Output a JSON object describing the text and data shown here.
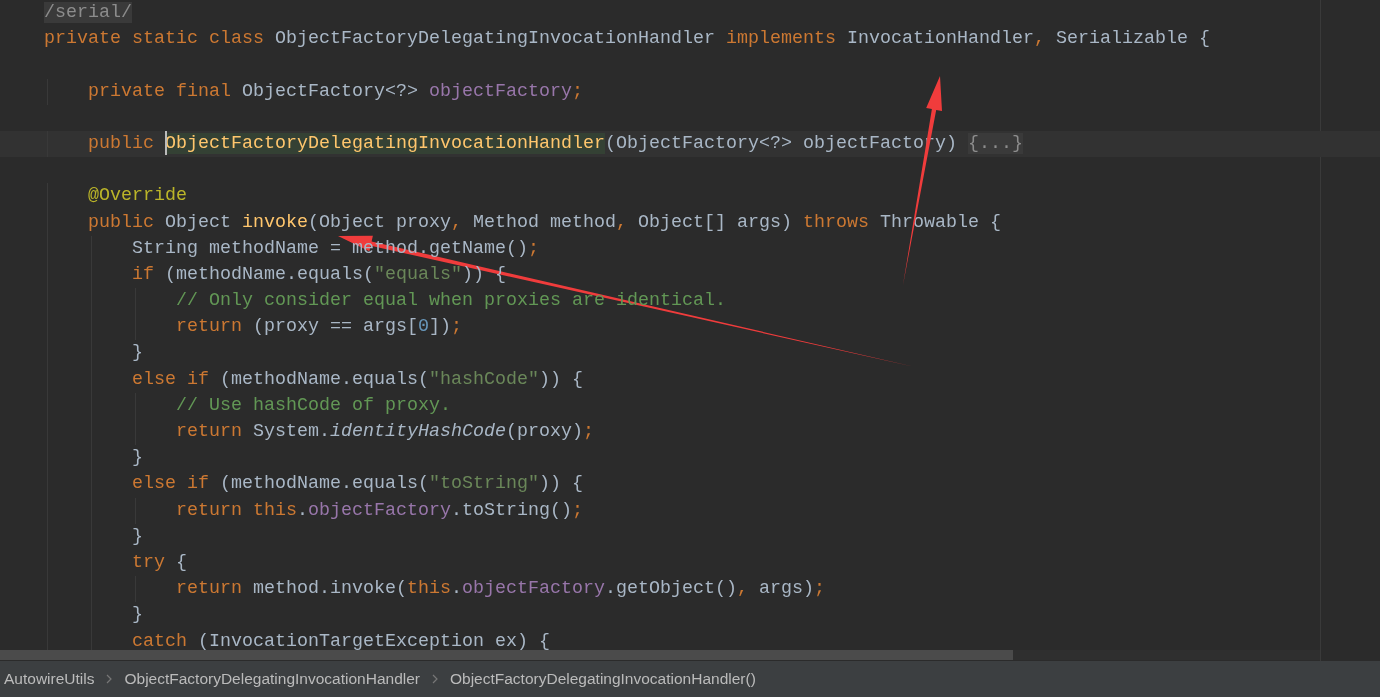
{
  "editor": {
    "lines": [
      {
        "kind": "code",
        "tokens": [
          {
            "kind": "fold",
            "text": "/serial/"
          }
        ]
      },
      {
        "kind": "code",
        "tokens": [
          {
            "kind": "kw",
            "text": "private static class "
          },
          {
            "kind": "plain",
            "text": "ObjectFactoryDelegatingInvocationHandler "
          },
          {
            "kind": "kw",
            "text": "implements "
          },
          {
            "kind": "plain",
            "text": "InvocationHandler"
          },
          {
            "kind": "kw",
            "text": ","
          },
          {
            "kind": "plain",
            "text": " Serializable {"
          }
        ]
      },
      {
        "kind": "blank"
      },
      {
        "kind": "code",
        "tokens": [
          {
            "kind": "kw",
            "text": "    private final "
          },
          {
            "kind": "plain",
            "text": "ObjectFactory<?> "
          },
          {
            "kind": "field",
            "text": "objectFactory"
          },
          {
            "kind": "kw",
            "text": ";"
          }
        ]
      },
      {
        "kind": "blank"
      },
      {
        "kind": "code",
        "current": true,
        "tokens": [
          {
            "kind": "kw",
            "text": "    public "
          },
          {
            "kind": "match",
            "text": "ObjectFactoryDelegatingInvocationHandler"
          },
          {
            "kind": "plain",
            "text": "(ObjectFactory<?> objectFactory) "
          },
          {
            "kind": "fold",
            "text": "{...}"
          }
        ]
      },
      {
        "kind": "blank"
      },
      {
        "kind": "code",
        "tokens": [
          {
            "kind": "annotation",
            "text": "    @Override"
          }
        ]
      },
      {
        "kind": "code",
        "tokens": [
          {
            "kind": "kw",
            "text": "    public "
          },
          {
            "kind": "plain",
            "text": "Object "
          },
          {
            "kind": "method",
            "text": "invoke"
          },
          {
            "kind": "plain",
            "text": "(Object proxy"
          },
          {
            "kind": "kw",
            "text": ","
          },
          {
            "kind": "plain",
            "text": " Method method"
          },
          {
            "kind": "kw",
            "text": ","
          },
          {
            "kind": "plain",
            "text": " Object[] args) "
          },
          {
            "kind": "kw",
            "text": "throws "
          },
          {
            "kind": "plain",
            "text": "Throwable {"
          }
        ]
      },
      {
        "kind": "code",
        "tokens": [
          {
            "kind": "plain",
            "text": "        String methodName = method.getName()"
          },
          {
            "kind": "kw",
            "text": ";"
          }
        ]
      },
      {
        "kind": "code",
        "tokens": [
          {
            "kind": "kw",
            "text": "        if "
          },
          {
            "kind": "plain",
            "text": "(methodName.equals("
          },
          {
            "kind": "string",
            "text": "\"equals\""
          },
          {
            "kind": "plain",
            "text": ")) {"
          }
        ]
      },
      {
        "kind": "code",
        "tokens": [
          {
            "kind": "comment",
            "text": "            // Only consider equal when proxies are identical."
          }
        ]
      },
      {
        "kind": "code",
        "tokens": [
          {
            "kind": "kw",
            "text": "            return "
          },
          {
            "kind": "plain",
            "text": "(proxy == args["
          },
          {
            "kind": "number",
            "text": "0"
          },
          {
            "kind": "plain",
            "text": "])"
          },
          {
            "kind": "kw",
            "text": ";"
          }
        ]
      },
      {
        "kind": "code",
        "tokens": [
          {
            "kind": "plain",
            "text": "        }"
          }
        ]
      },
      {
        "kind": "code",
        "tokens": [
          {
            "kind": "kw",
            "text": "        else if "
          },
          {
            "kind": "plain",
            "text": "(methodName.equals("
          },
          {
            "kind": "string",
            "text": "\"hashCode\""
          },
          {
            "kind": "plain",
            "text": ")) {"
          }
        ]
      },
      {
        "kind": "code",
        "tokens": [
          {
            "kind": "comment",
            "text": "            // Use hashCode of proxy."
          }
        ]
      },
      {
        "kind": "code",
        "tokens": [
          {
            "kind": "kw",
            "text": "            return "
          },
          {
            "kind": "plain",
            "text": "System."
          },
          {
            "kind": "static",
            "text": "identityHashCode"
          },
          {
            "kind": "plain",
            "text": "(proxy)"
          },
          {
            "kind": "kw",
            "text": ";"
          }
        ]
      },
      {
        "kind": "code",
        "tokens": [
          {
            "kind": "plain",
            "text": "        }"
          }
        ]
      },
      {
        "kind": "code",
        "tokens": [
          {
            "kind": "kw",
            "text": "        else if "
          },
          {
            "kind": "plain",
            "text": "(methodName.equals("
          },
          {
            "kind": "string",
            "text": "\"toString\""
          },
          {
            "kind": "plain",
            "text": ")) {"
          }
        ]
      },
      {
        "kind": "code",
        "tokens": [
          {
            "kind": "kw",
            "text": "            return this"
          },
          {
            "kind": "plain",
            "text": "."
          },
          {
            "kind": "field",
            "text": "objectFactory"
          },
          {
            "kind": "plain",
            "text": ".toString()"
          },
          {
            "kind": "kw",
            "text": ";"
          }
        ]
      },
      {
        "kind": "code",
        "tokens": [
          {
            "kind": "plain",
            "text": "        }"
          }
        ]
      },
      {
        "kind": "code",
        "tokens": [
          {
            "kind": "kw",
            "text": "        try "
          },
          {
            "kind": "plain",
            "text": "{"
          }
        ]
      },
      {
        "kind": "code",
        "tokens": [
          {
            "kind": "kw",
            "text": "            return "
          },
          {
            "kind": "plain",
            "text": "method.invoke("
          },
          {
            "kind": "kw",
            "text": "this"
          },
          {
            "kind": "plain",
            "text": "."
          },
          {
            "kind": "field",
            "text": "objectFactory"
          },
          {
            "kind": "plain",
            "text": ".getObject()"
          },
          {
            "kind": "kw",
            "text": ","
          },
          {
            "kind": "plain",
            "text": " args)"
          },
          {
            "kind": "kw",
            "text": ";"
          }
        ]
      },
      {
        "kind": "code",
        "tokens": [
          {
            "kind": "plain",
            "text": "        }"
          }
        ]
      },
      {
        "kind": "code",
        "tokens": [
          {
            "kind": "kw",
            "text": "        catch "
          },
          {
            "kind": "plain",
            "text": "(InvocationTargetException ex) {"
          }
        ]
      }
    ]
  },
  "breadcrumbs": [
    {
      "label": "AutowireUtils"
    },
    {
      "label": "ObjectFactoryDelegatingInvocationHandler"
    },
    {
      "label": "ObjectFactoryDelegatingInvocationHandler()"
    }
  ]
}
